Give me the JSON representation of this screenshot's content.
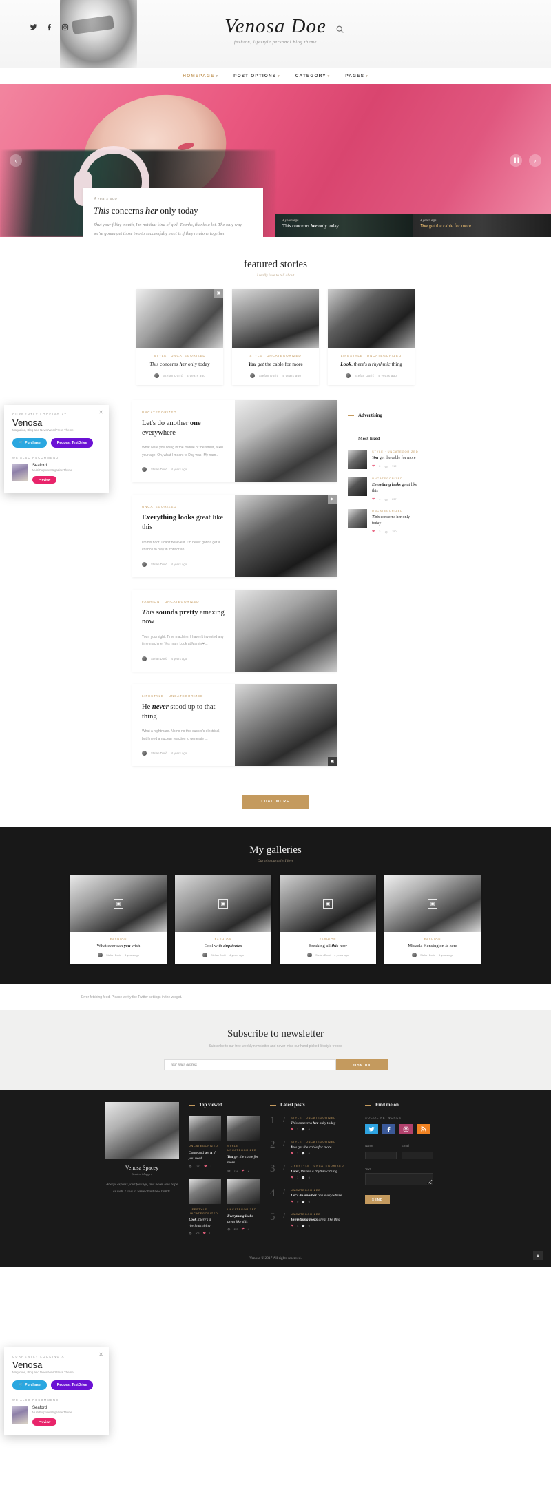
{
  "header": {
    "brand_title": "Venosa Doe",
    "brand_tagline": "fashion, lifestyle personal blog theme",
    "social": [
      {
        "name": "twitter-icon",
        "glyph": "ᵗ"
      },
      {
        "name": "facebook-icon",
        "glyph": "f"
      },
      {
        "name": "instagram-icon",
        "glyph": "▣"
      }
    ],
    "search_label": "search-icon"
  },
  "nav": {
    "items": [
      {
        "label": "HOMEPAGE",
        "active": true,
        "caret": "▾"
      },
      {
        "label": "POST OPTIONS",
        "active": false,
        "caret": "▾"
      },
      {
        "label": "CATEGORY",
        "active": false,
        "caret": "▾"
      },
      {
        "label": "PAGES",
        "active": false,
        "caret": "▾"
      }
    ]
  },
  "hero": {
    "prev_label": "‹",
    "next_label": "›",
    "pause_label": "▐▐",
    "caption": {
      "date": "4 years ago",
      "title_parts": {
        "pre": "This",
        "mid": " concerns ",
        "bold": "her",
        "post": " only today"
      },
      "excerpt": "Shut your filthy mouth, I'm not that kind of girl. Thanks, thanks a lot. The only way we're gonna get those two to successfully meet is if they're alone together."
    },
    "thumbs": [
      {
        "date": "4 years ago",
        "pre": "This concerns ",
        "bold": "her",
        "post": " only today",
        "active": false
      },
      {
        "date": "4 years ago",
        "pre": "You",
        "bold": " get the cable",
        "post": " for more",
        "active": true
      }
    ]
  },
  "featured": {
    "title": "featured stories",
    "subtitle": "I really love to tell about",
    "cards": [
      {
        "categories": [
          "STYLE",
          "UNCATEGORIZED"
        ],
        "title_pre": "This",
        "title_mid": " concerns ",
        "title_bold": "her",
        "title_post": " only today",
        "author": "Stefan Dorić",
        "date": "4 years ago",
        "corner_icon": "camera-icon",
        "corner_glyph": "▣",
        "has_corner": true
      },
      {
        "categories": [
          "STYLE",
          "UNCATEGORIZED"
        ],
        "title_pre": "You",
        "title_mid": " get",
        "title_bold": " the cable",
        "title_post": " for more",
        "author": "Stefan Dorić",
        "date": "4 years ago",
        "corner_icon": "",
        "corner_glyph": "",
        "has_corner": false
      },
      {
        "categories": [
          "LIFESTYLE",
          "UNCATEGORIZED"
        ],
        "title_pre": "Look",
        "title_mid": ", there's a ",
        "title_bold": "rhythmic",
        "title_post": " thing",
        "author": "Stefan Dorić",
        "date": "4 years ago",
        "corner_icon": "",
        "corner_glyph": "",
        "has_corner": false
      }
    ]
  },
  "posts": [
    {
      "categories": [
        "UNCATEGORIZED"
      ],
      "title_pre": "Let's do another ",
      "title_bold": "one",
      "title_post": " everywhere",
      "excerpt": "What were you doing in the middle of the street, a kid your age. Oh, what I meant to Day was- My nam...",
      "author": "Stefan Dorić",
      "date": "4 years ago",
      "image_side": "right",
      "badge": "",
      "badge_pos": ""
    },
    {
      "categories": [
        "UNCATEGORIZED"
      ],
      "title_pre": "",
      "title_bold": "Everything looks",
      "title_post": " great like this",
      "excerpt": "I'm his hoof. I can't believe it. I'm never gonna get a chance to play in front of an ...",
      "author": "Stefan Dorić",
      "date": "4 years ago",
      "image_side": "right",
      "badge": "▶",
      "badge_pos": "top"
    },
    {
      "categories": [
        "FASHION",
        "UNCATEGORIZED"
      ],
      "title_pre": "This",
      "title_bold": " sounds pretty",
      "title_post": " amazing now",
      "excerpt": "Your, your right. Time machine. I haven't invented any time machine. Yes man. Look at Marvin❤...",
      "author": "Stefan Dorić",
      "date": "4 years ago",
      "image_side": "right",
      "badge": "",
      "badge_pos": ""
    },
    {
      "categories": [
        "LIFESTYLE",
        "UNCATEGORIZED"
      ],
      "title_pre": "He ",
      "title_bold": "never",
      "title_post": " stood up to that thing",
      "excerpt": "What a nightmare. No no no this sucker's electrical, but I need a nuclear reaction to generate ...",
      "author": "Stefan Dorić",
      "date": "4 years ago",
      "image_side": "right",
      "badge": "▣",
      "badge_pos": "bottom"
    }
  ],
  "sidebar": {
    "advertising_title": "Advertising",
    "most_liked_title": "Most liked",
    "most_liked": [
      {
        "categories": [
          "STYLE",
          "UNCATEGORIZED"
        ],
        "title_bold": "You",
        "title_rest": " get the cable for more",
        "likes": "2",
        "views": "712"
      },
      {
        "categories": [
          "UNCATEGORIZED"
        ],
        "title_bold": "Everything looks",
        "title_rest": " great like this",
        "likes": "4",
        "views": "237"
      },
      {
        "categories": [
          "UNCATEGORIZED"
        ],
        "title_bold": "This",
        "title_rest": " concerns her only today",
        "likes": "2",
        "views": "150"
      }
    ]
  },
  "load_more": "LOAD MORE",
  "galleries": {
    "title": "My galleries",
    "subtitle": "Our photography I love",
    "cards": [
      {
        "categories": [
          "FASHION"
        ],
        "title_pre": "What ever can ",
        "title_bold": "you",
        "title_post": " wish",
        "author": "Stefan Dorić",
        "date": "4 years ago",
        "icon": "gallery-icon",
        "glyph": "▣"
      },
      {
        "categories": [
          "FASHION"
        ],
        "title_pre": "Cool with ",
        "title_bold": "duplicates",
        "title_post": "",
        "author": "Stefan Dorić",
        "date": "4 years ago",
        "icon": "gallery-icon",
        "glyph": "▣"
      },
      {
        "categories": [
          "FASHION"
        ],
        "title_pre": "Breaking all ",
        "title_bold": "this",
        "title_post": " now",
        "author": "Stefan Dorić",
        "date": "4 years ago",
        "icon": "gallery-icon",
        "glyph": "▣"
      },
      {
        "categories": [
          "FASHION"
        ],
        "title_pre": "Micaela Kensington ",
        "title_bold": "is",
        "title_post": " here",
        "author": "Stefan Dorić",
        "date": "4 years ago",
        "icon": "gallery-icon",
        "glyph": "▣"
      }
    ]
  },
  "twitter_error": "Error fetching feed. Please verify the Twitter settings in the widget.",
  "newsletter": {
    "title": "Subscribe to newsletter",
    "subtitle": "Subscribe to our free weekly newsletter and never miss our hand-picked lifestyle trends",
    "placeholder": "Your email address",
    "button": "SIGN UP"
  },
  "footer": {
    "about": {
      "name": "Venosa Spacey",
      "role": "fashion blogger",
      "text": "Always express your feelings, and never lose hope as well. I love to write about new trends."
    },
    "top_viewed": {
      "title": "Top viewed",
      "items": [
        {
          "categories": [
            "UNCATEGORIZED"
          ],
          "title_pre": "Come and ",
          "title_bold": "get it",
          "title_post": " if you need",
          "views": "1167",
          "likes": "1"
        },
        {
          "categories": [
            "STYLE",
            "UNCATEGORIZED"
          ],
          "title_bold": "You",
          "title_pre": "",
          "title_post": " get the cable for more",
          "views": "712",
          "likes": "2"
        },
        {
          "categories": [
            "LIFESTYLE",
            "UNCATEGORIZED"
          ],
          "title_bold": "Look",
          "title_pre": "",
          "title_post": ", there's a rhythmic thing",
          "views": "403",
          "likes": "1"
        },
        {
          "categories": [
            "UNCATEGORIZED"
          ],
          "title_bold": "Everything looks",
          "title_pre": "",
          "title_post": " great like this",
          "views": "237",
          "likes": "4"
        }
      ]
    },
    "latest_posts": {
      "title": "Latest posts",
      "items": [
        {
          "num": "1",
          "categories": [
            "STYLE",
            "UNCATEGORIZED"
          ],
          "title_pre": "This",
          "title_mid": " concerns ",
          "title_bold": "her",
          "title_post": " only today",
          "likes": "2",
          "comments": "0"
        },
        {
          "num": "2",
          "categories": [
            "STYLE",
            "UNCATEGORIZED"
          ],
          "title_pre": "",
          "title_mid": "",
          "title_bold": "You",
          "title_post": " get the cable for more",
          "likes": "2",
          "comments": "0"
        },
        {
          "num": "3",
          "categories": [
            "LIFESTYLE",
            "UNCATEGORIZED"
          ],
          "title_pre": "",
          "title_mid": "",
          "title_bold": "Look",
          "title_post": ", there's a rhythmic thing",
          "likes": "1",
          "comments": "0"
        },
        {
          "num": "4",
          "categories": [
            "UNCATEGORIZED"
          ],
          "title_pre": "",
          "title_mid": "",
          "title_bold": "Let's do another",
          "title_post": " one everywhere",
          "likes": "0",
          "comments": "0"
        },
        {
          "num": "5",
          "categories": [
            "UNCATEGORIZED"
          ],
          "title_pre": "",
          "title_mid": "",
          "title_bold": "Everything looks",
          "title_post": " great like this",
          "likes": "4",
          "comments": "0"
        }
      ]
    },
    "find_me": {
      "title": "Find me on",
      "subtitle": "SOCIAL NETWORKS",
      "socials": [
        {
          "name": "twitter-icon",
          "glyph": "ᵗ",
          "color": "#2ea3e0"
        },
        {
          "name": "facebook-icon",
          "glyph": "f",
          "color": "#3b5998"
        },
        {
          "name": "instagram-icon",
          "glyph": "▣",
          "color": "#b1416c"
        },
        {
          "name": "rss-icon",
          "glyph": "◔",
          "color": "#f08222"
        }
      ],
      "name_label": "Name",
      "email_label": "Email",
      "text_label": "Text",
      "send_label": "SEND"
    },
    "copyright": "Venosa © 2017 All rights reserved.",
    "to_top": "▲"
  },
  "promos": [
    {
      "kicker": "CURRENTLY LOOKING AT",
      "name": "Venosa",
      "desc": "Magazine, Blog and News WordPress Theme",
      "buy_label": "Purchase",
      "test_label": "Request TestDrive",
      "rec_label": "WE ALSO RECOMMEND",
      "rec_name": "Seaford",
      "rec_desc": "Multi-Purpose Magazine Theme",
      "preview_label": "Preview",
      "close": "✕"
    },
    {
      "kicker": "CURRENTLY LOOKING AT",
      "name": "Venosa",
      "desc": "Magazine, Blog and News WordPress Theme",
      "buy_label": "Purchase",
      "test_label": "Request TestDrive",
      "rec_label": "WE ALSO RECOMMEND",
      "rec_name": "Seaford",
      "rec_desc": "Multi-Purpose Magazine Theme",
      "preview_label": "Preview",
      "close": "✕"
    }
  ]
}
